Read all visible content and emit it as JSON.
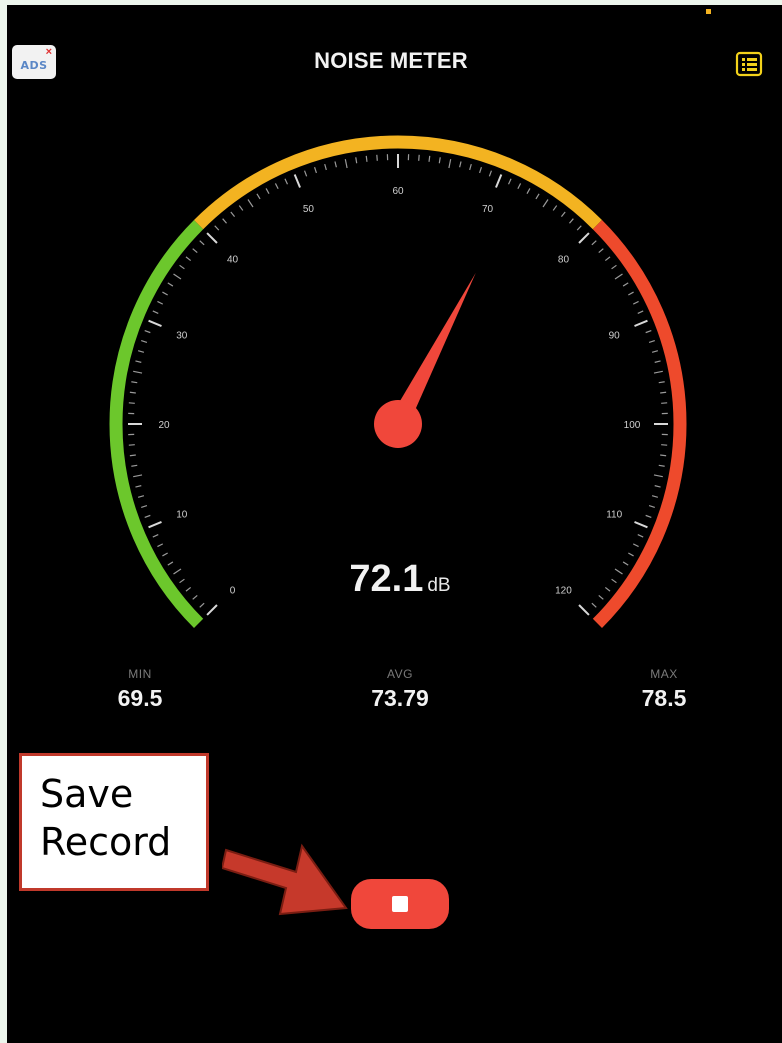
{
  "header": {
    "title": "NOISE METER",
    "ads_label": "ADS",
    "ads_close": "×",
    "history_icon": "list-icon"
  },
  "gauge": {
    "min_value": 0,
    "max_value": 120,
    "current_value": 72.1,
    "tick_labels": [
      "0",
      "10",
      "20",
      "30",
      "40",
      "50",
      "60",
      "70",
      "80",
      "90",
      "100",
      "110",
      "120"
    ],
    "zones": [
      {
        "from": 0,
        "to": 40,
        "color": "#6cc72c"
      },
      {
        "from": 40,
        "to": 80,
        "color": "#f3b321"
      },
      {
        "from": 80,
        "to": 120,
        "color": "#ee4a2c"
      }
    ],
    "needle_color": "#f0473b"
  },
  "reading": {
    "value": "72.1",
    "unit": "dB"
  },
  "stats": {
    "min_label": "MIN",
    "min_value": "69.5",
    "avg_label": "AVG",
    "avg_value": "73.79",
    "max_label": "MAX",
    "max_value": "78.5"
  },
  "annotation": {
    "callout_line1": "Save",
    "callout_line2": "Record"
  },
  "controls": {
    "stop_icon": "stop-icon",
    "button_color": "#f0473b"
  }
}
